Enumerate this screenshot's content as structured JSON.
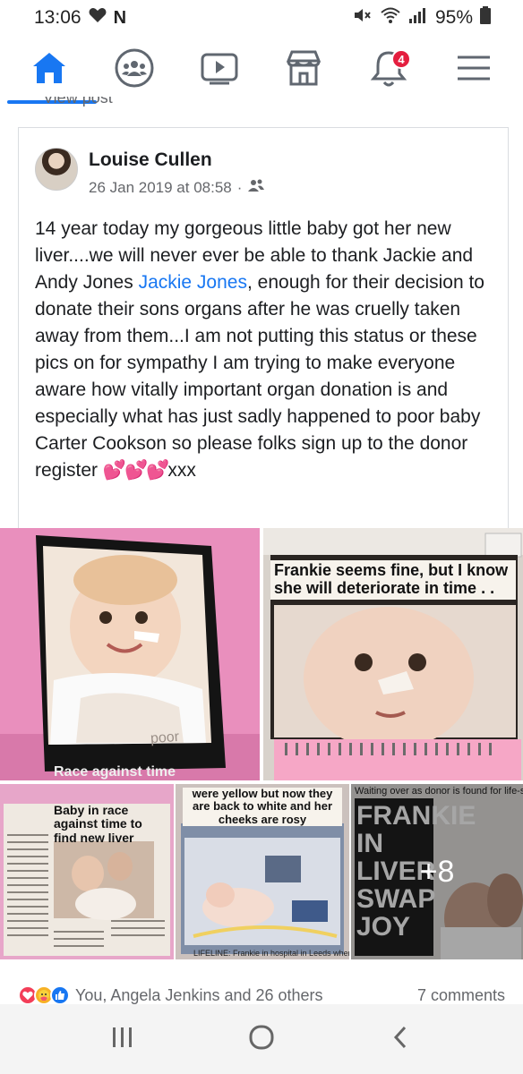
{
  "status_bar": {
    "time": "13:06",
    "battery": "95%",
    "icons": [
      "heart-icon",
      "n-notification-icon",
      "mute-icon",
      "wifi-icon",
      "signal-icon",
      "battery-icon"
    ]
  },
  "nav": {
    "items": [
      {
        "name": "home-icon",
        "active": true
      },
      {
        "name": "groups-icon"
      },
      {
        "name": "watch-icon"
      },
      {
        "name": "marketplace-icon"
      },
      {
        "name": "notifications-icon",
        "badge": "4"
      },
      {
        "name": "menu-icon"
      }
    ],
    "accent": "#1877f2"
  },
  "view_post": "View post",
  "post": {
    "author": "Louise Cullen",
    "timestamp": "26 Jan 2019 at 08:58",
    "audience_icon": "friends-icon",
    "text_before": "14 year today my gorgeous little baby got her new liver....we will never ever be able to thank Jackie and Andy Jones ",
    "mention": "Jackie Jones",
    "text_after": ", enough for their decision to donate their sons organs after he was cruelly taken away from them...I am not putting this status or these pics on for sympathy I am trying to make everyone aware how vitally important organ donation is and especially what has just sadly happened to poor baby Carter Cookson so please folks sign up to the donor register ",
    "hearts": "💕💕💕",
    "text_end": "xxx"
  },
  "photos": {
    "p1_caption": "poor",
    "p1_footer": "Race against time",
    "p2_headline": "Frankie seems fine, but I know she will deteriorate in time . .",
    "p3_headline": "Baby in race against time to find new liver",
    "p4_headline": "were yellow but now they are back to white and her cheeks are rosy",
    "p4_footer": "LIFELINE: Frankie in hospital in Leeds where",
    "p5_top": "Waiting over as donor is found for life-saving op",
    "p5_headline": "FRANKIE IN LIVER SWAP JOY",
    "more_count": "+8"
  },
  "reactions": {
    "summary": "You, Angela Jenkins and 26 others",
    "comments": "7 comments",
    "icons": [
      "love-reaction-icon",
      "care-reaction-icon",
      "like-reaction-icon"
    ]
  },
  "android_nav": [
    "recent-apps-icon",
    "home-circle-icon",
    "back-icon"
  ]
}
